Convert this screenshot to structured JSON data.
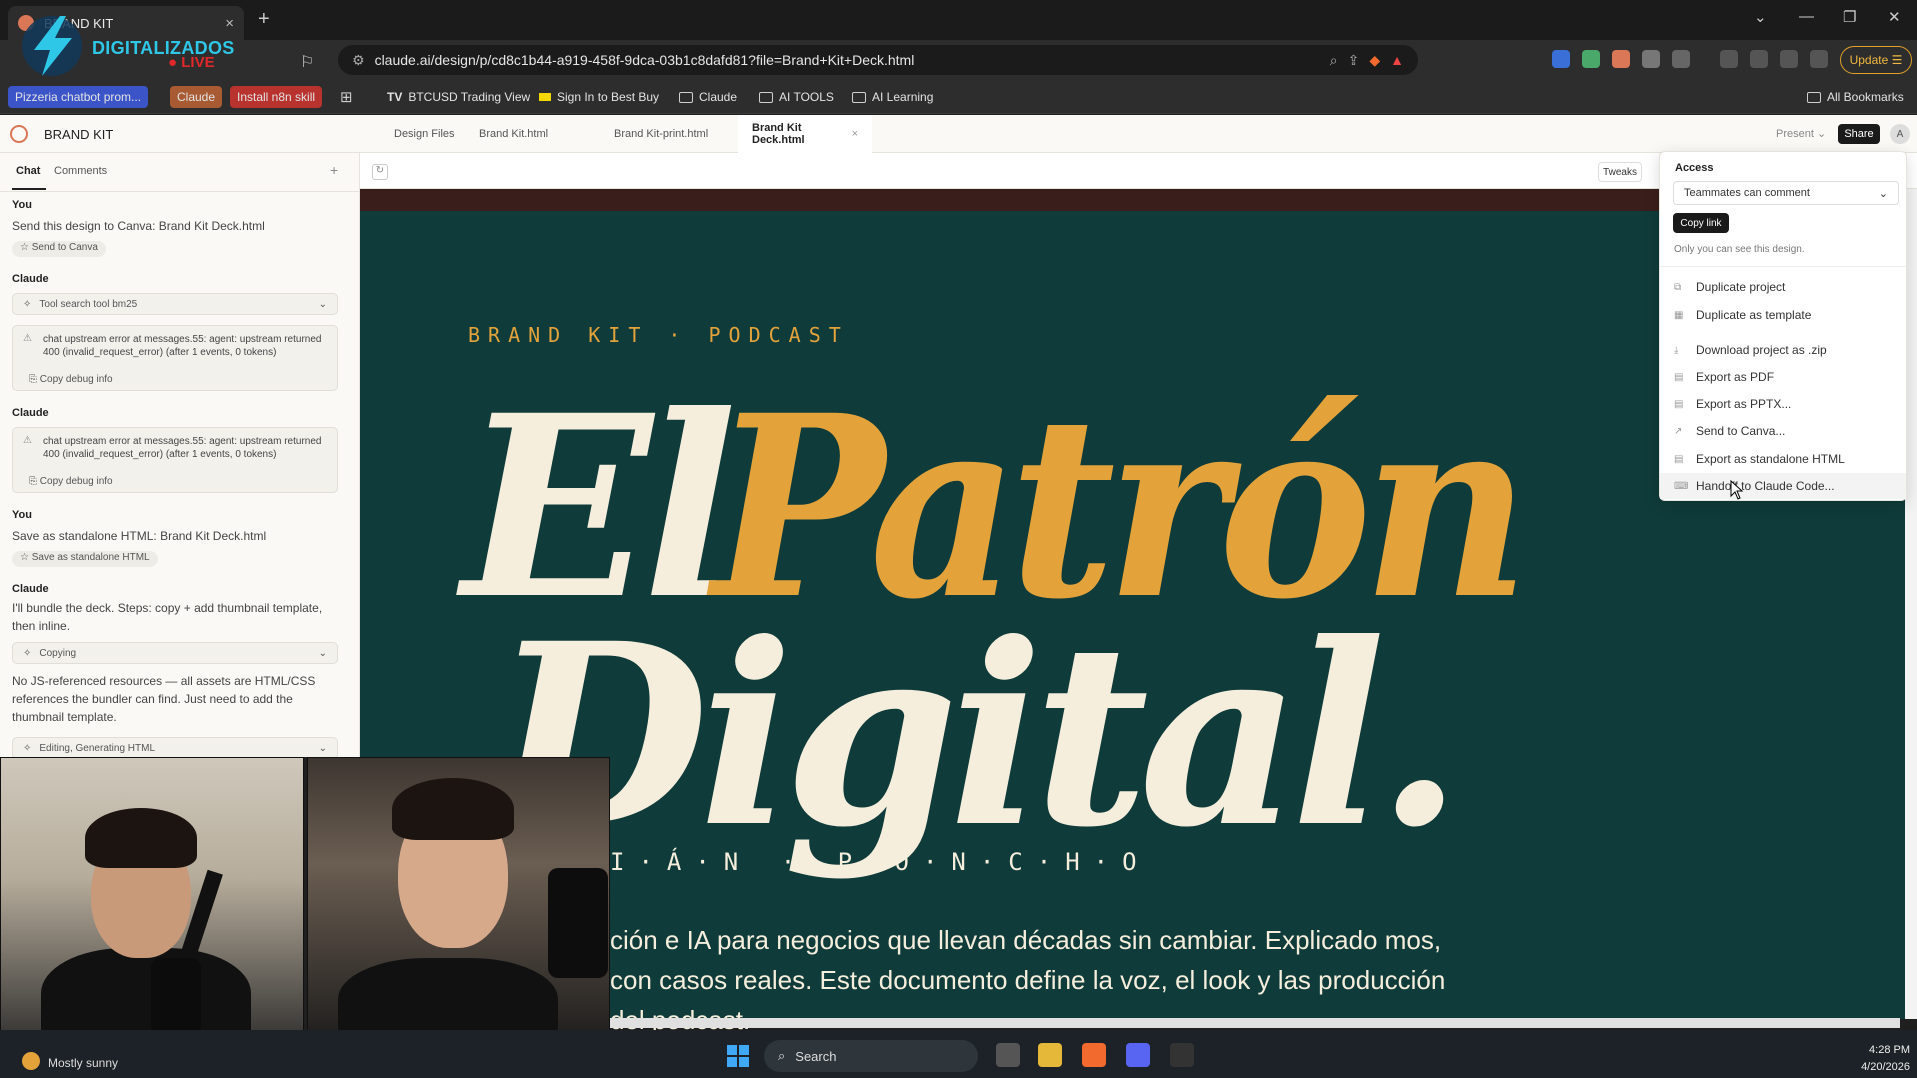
{
  "browser": {
    "tab_title": "BRAND KIT",
    "url": "claude.ai/design/p/cd8c1b44-a919-458f-9dca-03b1c8dafd81?file=Brand+Kit+Deck.html",
    "update_label": "Update",
    "logo_text": "DIGITALIZADOS",
    "logo_live": "LIVE",
    "bookmarks": [
      {
        "label": "Pizzeria chatbot prom...",
        "color": "#3b55c9"
      },
      {
        "label": "Claude",
        "color": "#a85a32"
      },
      {
        "label": "Install n8n skill",
        "color": "#b8322e"
      },
      {
        "label": "BTCUSD Trading View",
        "icon": "tradingview-icon"
      },
      {
        "label": "Sign In to Best Buy",
        "icon": "bestbuy-icon"
      },
      {
        "label": "Claude",
        "icon": "folder-icon"
      },
      {
        "label": "AI TOOLS",
        "icon": "folder-icon"
      },
      {
        "label": "AI Learning",
        "icon": "folder-icon"
      }
    ],
    "all_bookmarks": "All Bookmarks"
  },
  "app": {
    "title": "BRAND KIT",
    "file_tabs": [
      "Design Files",
      "Brand Kit.html",
      "Brand Kit-print.html",
      "Brand Kit Deck.html"
    ],
    "active_tab": "Brand Kit Deck.html",
    "present_label": "Present",
    "share_label": "Share",
    "avatar_initial": "A",
    "tweaks_label": "Tweaks"
  },
  "chat": {
    "tabs": [
      "Chat",
      "Comments"
    ],
    "add": "+",
    "you_label": "You",
    "claude_label": "Claude",
    "msg1": "Send this design to Canva: Brand Kit Deck.html",
    "chip1": "Send to Canva",
    "tool1": "Tool search tool bm25",
    "error_text": "chat upstream error at messages.55: agent: upstream returned 400 (invalid_request_error) (after 1 events, 0 tokens)",
    "copy_debug": "Copy debug info",
    "msg2": "Save as standalone HTML: Brand Kit Deck.html",
    "chip2": "Save as standalone HTML",
    "msg3": "I'll bundle the deck. Steps: copy + add thumbnail template, then inline.",
    "tool2": "Copying",
    "msg4": "No JS-referenced resources — all assets are HTML/CSS references the bundler can find. Just need to add the thumbnail template.",
    "tool3": "Editing, Generating HTML"
  },
  "slide": {
    "eyebrow": "BRAND KIT · PODCAST",
    "title_el": "El",
    "title_patron": "Patrón",
    "title_digital": "Digital.",
    "names": "I·Á·N  ·  P·O·N·C·H·O",
    "desc": "ción e IA para negocios que llevan décadas sin cambiar. Explicado mos, con casos reales. Este documento define la voz, el look y las producción del podcast.",
    "colors": {
      "bg": "#0f3b3a",
      "cream": "#f5eedc",
      "gold": "#e3a33a"
    }
  },
  "share_menu": {
    "access_label": "Access",
    "access_value": "Teammates can comment",
    "copy_link": "Copy link",
    "note": "Only you can see this design.",
    "items": [
      "Duplicate project",
      "Duplicate as template",
      "Download project as .zip",
      "Export as PDF",
      "Export as PPTX...",
      "Send to Canva...",
      "Export as standalone HTML",
      "Handoff to Claude Code..."
    ]
  },
  "taskbar": {
    "weather": "Mostly sunny",
    "search": "Search",
    "time": "4:28 PM",
    "date": "4/20/2026"
  }
}
